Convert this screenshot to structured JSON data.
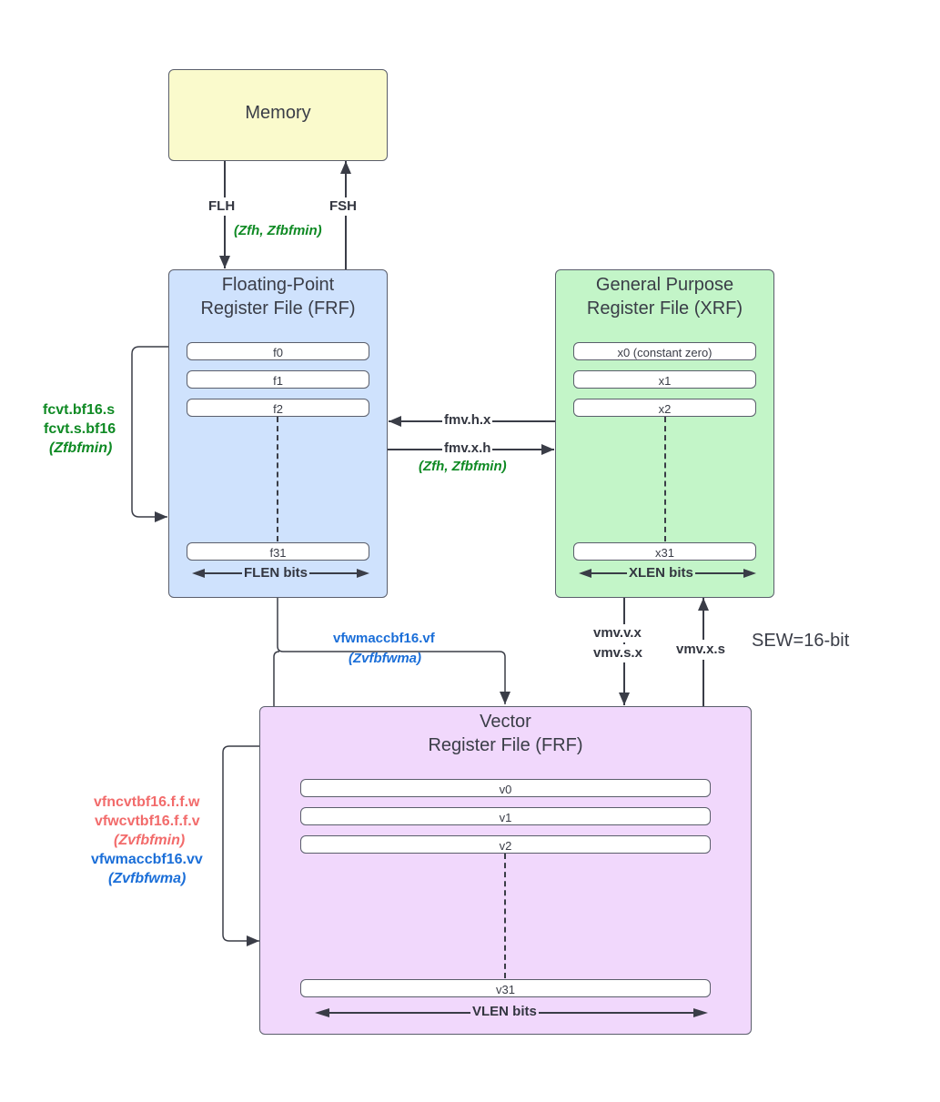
{
  "memory": {
    "title": "Memory",
    "fill": "#fafacc"
  },
  "frf": {
    "title_line1": "Floating-Point",
    "title_line2": "Register File (FRF)",
    "fill": "#cfe2fd",
    "registers": {
      "first": "f0",
      "second": "f1",
      "third": "f2",
      "last": "f31"
    },
    "width_label": "FLEN bits"
  },
  "xrf": {
    "title_line1": "General Purpose",
    "title_line2": "Register File (XRF)",
    "fill": "#c3f5c8",
    "registers": {
      "first": "x0 (constant zero)",
      "second": "x1",
      "third": "x2",
      "last": "x31"
    },
    "width_label": "XLEN bits"
  },
  "vrf": {
    "title_line1": "Vector",
    "title_line2": "Register File (FRF)",
    "fill": "#f1d8fc",
    "registers": {
      "first": "v0",
      "second": "v1",
      "third": "v2",
      "last": "v31"
    },
    "width_label": "VLEN bits"
  },
  "edges": {
    "load": "FLH",
    "store": "FSH",
    "mem_ext": "(Zfh, Zfbfmin)",
    "frf_self_line1": "fcvt.bf16.s",
    "frf_self_line2": "fcvt.s.bf16",
    "frf_self_ext": "(Zfbfmin)",
    "x_to_f": "fmv.h.x",
    "f_to_x": "fmv.x.h",
    "fx_ext": "(Zfh, Zfbfmin)",
    "f_to_v": "vfwmaccbf16.vf",
    "f_to_v_ext": "(Zvfbfwma)",
    "x_to_v_line1": "vmv.v.x",
    "x_to_v_line2": "vmv.s.x",
    "v_to_x": "vmv.x.s",
    "sew_note": "SEW=16-bit",
    "vrf_self_line1": "vfncvtbf16.f.f.w",
    "vrf_self_line2": "vfwcvtbf16.f.f.v",
    "vrf_self_ext1": "(Zvfbfmin)",
    "vrf_self_line3": "vfwmaccbf16.vv",
    "vrf_self_ext2": "(Zvfbfwma)"
  }
}
